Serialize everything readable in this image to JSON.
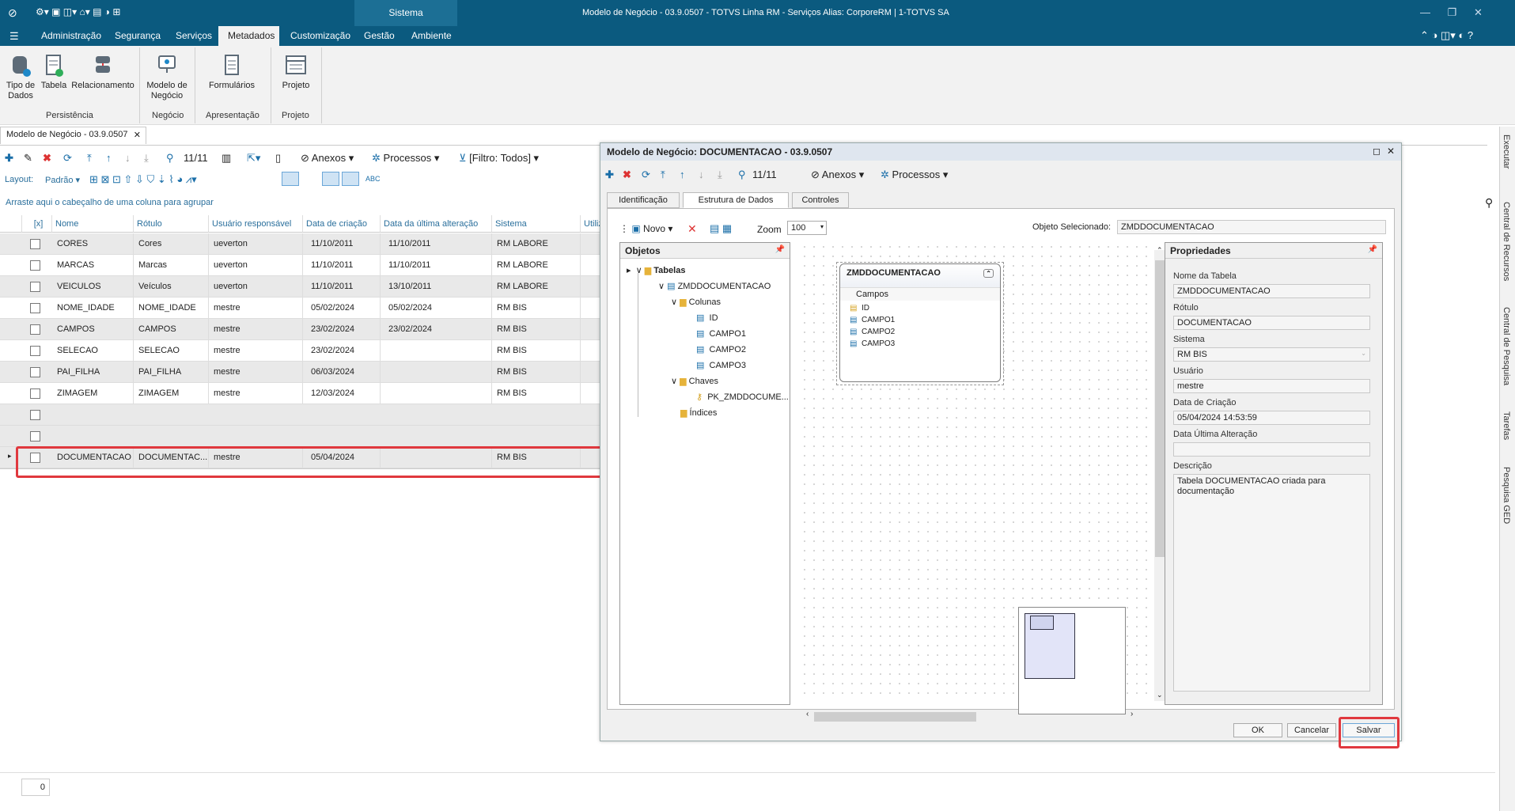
{
  "window": {
    "title": "Modelo de Negócio - 03.9.0507 - TOTVS Linha RM - Serviços  Alias: CorporeRM | 1-TOTVS SA",
    "center_tab": "Sistema"
  },
  "menu": {
    "items": [
      "Administração",
      "Segurança",
      "Serviços",
      "Metadados",
      "Customização",
      "Gestão",
      "Ambiente"
    ],
    "active": "Metadados"
  },
  "ribbon": {
    "tipo_dados": "Tipo de\nDados",
    "tabela": "Tabela",
    "relacionamento": "Relacionamento",
    "modelo_negocio": "Modelo de\nNegócio",
    "formularios": "Formulários",
    "projeto": "Projeto",
    "groups": {
      "persistencia": "Persistência",
      "negocio": "Negócio",
      "apresentacao": "Apresentação",
      "projeto": "Projeto"
    }
  },
  "doc_tab": "Modelo de Negócio - 03.9.0507",
  "toolbar": {
    "counter": "11/11",
    "anexos": "Anexos",
    "processos": "Processos",
    "filtro": "[Filtro: Todos]",
    "layout_label": "Layout:",
    "layout_value": "Padrão"
  },
  "group_hint": "Arraste aqui o cabeçalho de uma coluna para agrupar",
  "grid": {
    "columns": [
      "[x]",
      "Nome",
      "Rótulo",
      "Usuário responsável",
      "Data de criação",
      "Data da última alteração",
      "Sistema",
      "Utiliz"
    ],
    "rows": [
      [
        "CORES",
        "Cores",
        "ueverton",
        "11/10/2011",
        "11/10/2011",
        "RM LABORE"
      ],
      [
        "MARCAS",
        "Marcas",
        "ueverton",
        "11/10/2011",
        "11/10/2011",
        "RM LABORE"
      ],
      [
        "VEICULOS",
        "Veículos",
        "ueverton",
        "11/10/2011",
        "13/10/2011",
        "RM LABORE"
      ],
      [
        "NOME_IDADE",
        "NOME_IDADE",
        "mestre",
        "05/02/2024",
        "05/02/2024",
        "RM BIS"
      ],
      [
        "CAMPOS",
        "CAMPOS",
        "mestre",
        "23/02/2024",
        "23/02/2024",
        "RM BIS"
      ],
      [
        "SELECAO",
        "SELECAO",
        "mestre",
        "23/02/2024",
        "",
        "RM BIS"
      ],
      [
        "PAI_FILHA",
        "PAI_FILHA",
        "mestre",
        "06/03/2024",
        "",
        "RM BIS"
      ],
      [
        "ZIMAGEM",
        "ZIMAGEM",
        "mestre",
        "12/03/2024",
        "",
        "RM BIS"
      ]
    ],
    "new_row": [
      "DOCUMENTACAO",
      "DOCUMENTAC...",
      "mestre",
      "05/04/2024",
      "",
      "RM BIS"
    ]
  },
  "status_count": "0",
  "right_rail": [
    "Executar",
    "Central de Recursos",
    "Central de Pesquisa",
    "Tarefas",
    "Pesquisa GED"
  ],
  "dialog": {
    "title": "Modelo de Negócio: DOCUMENTACAO - 03.9.0507",
    "counter": "11/11",
    "anexos": "Anexos",
    "processos": "Processos",
    "tabs": [
      "Identificação",
      "Estrutura de Dados",
      "Controles"
    ],
    "novo": "Novo",
    "zoom_label": "Zoom",
    "zoom_value": "100",
    "objeto_sel_label": "Objeto Selecionado:",
    "objeto_sel_value": "ZMDDOCUMENTACAO",
    "objetos_title": "Objetos",
    "tree": {
      "tabelas": "Tabelas",
      "table": "ZMDDOCUMENTACAO",
      "colunas": "Colunas",
      "columns": [
        "ID",
        "CAMPO1",
        "CAMPO2",
        "CAMPO3"
      ],
      "chaves": "Chaves",
      "pk": "PK_ZMDDOCUME...",
      "indices": "Índices"
    },
    "entity": {
      "name": "ZMDDOCUMENTACAO",
      "section": "Campos",
      "fields": [
        "ID",
        "CAMPO1",
        "CAMPO2",
        "CAMPO3"
      ]
    },
    "props": {
      "title": "Propriedades",
      "nome_tabela_label": "Nome da Tabela",
      "nome_tabela": "ZMDDOCUMENTACAO",
      "rotulo_label": "Rótulo",
      "rotulo": "DOCUMENTACAO",
      "sistema_label": "Sistema",
      "sistema": "RM BIS",
      "usuario_label": "Usuário",
      "usuario": "mestre",
      "data_criacao_label": "Data de Criação",
      "data_criacao": "05/04/2024 14:53:59",
      "data_alt_label": "Data Última Alteração",
      "data_alt": "",
      "descricao_label": "Descrição",
      "descricao": "Tabela DOCUMENTACAO criada para documentação"
    },
    "buttons": {
      "ok": "OK",
      "cancelar": "Cancelar",
      "salvar": "Salvar"
    }
  },
  "colors": {
    "titlebar": "#0b5a7f",
    "highlight": "#e0383e",
    "link": "#2a6f9c"
  }
}
